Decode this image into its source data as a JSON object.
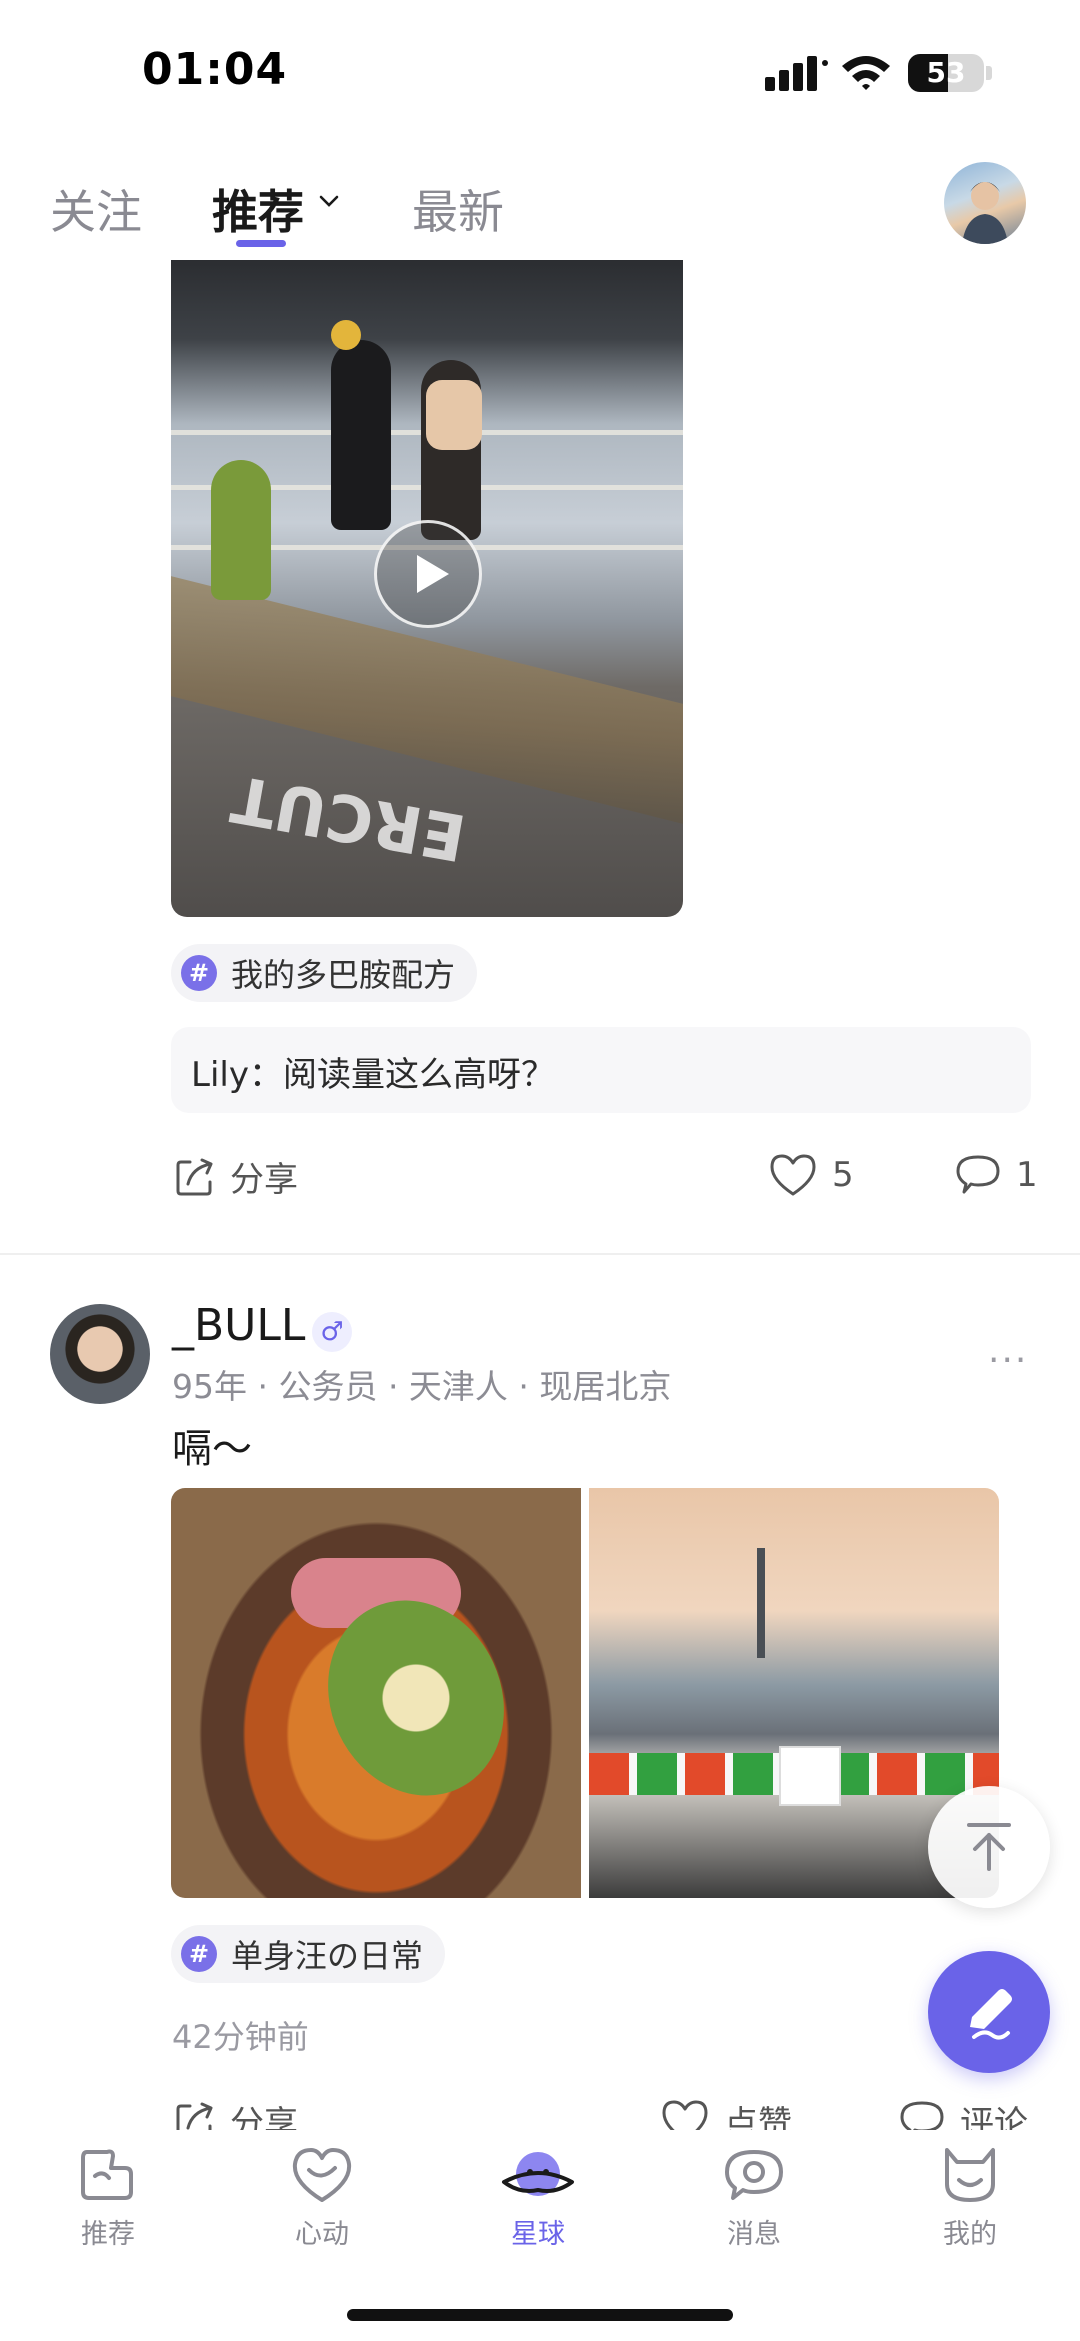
{
  "status_bar": {
    "time": "01:04",
    "battery": "53",
    "battery_level": 53
  },
  "top_tabs": {
    "follow": "关注",
    "recommend": "推荐",
    "latest": "最新",
    "active": "推荐"
  },
  "post1": {
    "hashtag": "我的多巴胺配方",
    "comment_preview": "Lily：阅读量这么高呀？",
    "share_label": "分享",
    "like_count": "5",
    "comment_count": "1",
    "video_overlay_text": "ERCUT"
  },
  "post2": {
    "author": "_BULL",
    "gender_icon": "♂",
    "meta": "95年 · 公务员 · 天津人 · 现居北京",
    "text": "嗝～",
    "hashtag": "单身汪の日常",
    "time": "42分钟前",
    "share_label": "分享",
    "like_label": "点赞",
    "comment_label": "评论",
    "more": "···"
  },
  "bottom_nav": [
    {
      "label": "推荐",
      "icon": "recommend-icon"
    },
    {
      "label": "心动",
      "icon": "heart-face-icon"
    },
    {
      "label": "星球",
      "icon": "planet-icon",
      "active": true
    },
    {
      "label": "消息",
      "icon": "message-icon"
    },
    {
      "label": "我的",
      "icon": "cat-profile-icon"
    }
  ],
  "colors": {
    "accent": "#6a63e8",
    "text_muted": "#8a8a92",
    "hashtag_bg": "#f3f3f6"
  }
}
